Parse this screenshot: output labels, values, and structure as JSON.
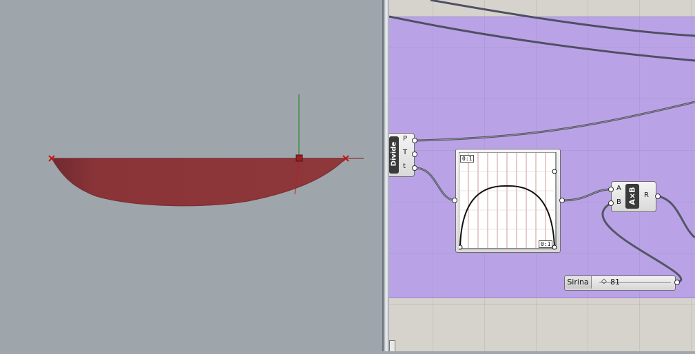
{
  "divide_component": {
    "label": "Divide",
    "outputs": [
      "P",
      "T",
      "t"
    ]
  },
  "graph_mapper": {
    "domain_top": "0:1",
    "domain_bottom": "0:1"
  },
  "multiply_component": {
    "label": "A×B",
    "input_a": "A",
    "input_b": "B",
    "output": "R"
  },
  "slider": {
    "name": "Sirina",
    "value": "81"
  }
}
